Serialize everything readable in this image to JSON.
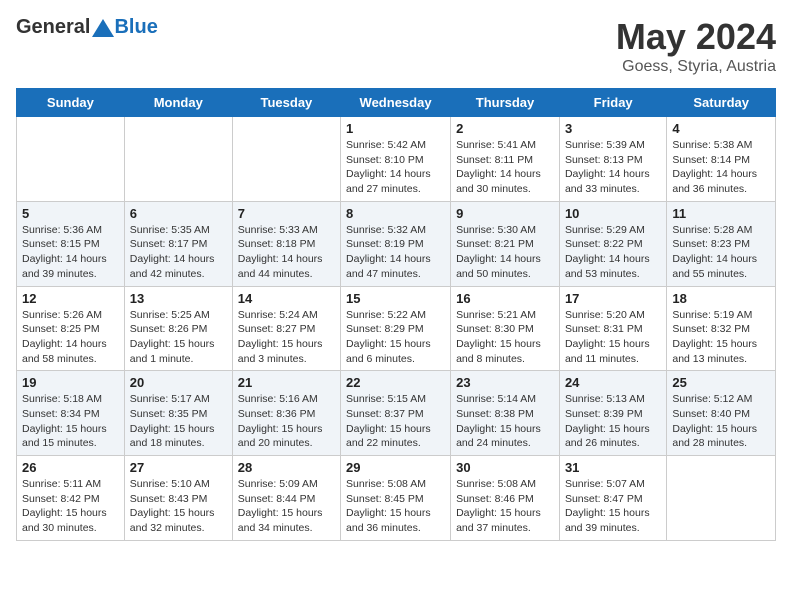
{
  "header": {
    "logo_general": "General",
    "logo_blue": "Blue",
    "title": "May 2024",
    "location": "Goess, Styria, Austria"
  },
  "days_of_week": [
    "Sunday",
    "Monday",
    "Tuesday",
    "Wednesday",
    "Thursday",
    "Friday",
    "Saturday"
  ],
  "weeks": [
    [
      {
        "day": "",
        "info": ""
      },
      {
        "day": "",
        "info": ""
      },
      {
        "day": "",
        "info": ""
      },
      {
        "day": "1",
        "info": "Sunrise: 5:42 AM\nSunset: 8:10 PM\nDaylight: 14 hours and 27 minutes."
      },
      {
        "day": "2",
        "info": "Sunrise: 5:41 AM\nSunset: 8:11 PM\nDaylight: 14 hours and 30 minutes."
      },
      {
        "day": "3",
        "info": "Sunrise: 5:39 AM\nSunset: 8:13 PM\nDaylight: 14 hours and 33 minutes."
      },
      {
        "day": "4",
        "info": "Sunrise: 5:38 AM\nSunset: 8:14 PM\nDaylight: 14 hours and 36 minutes."
      }
    ],
    [
      {
        "day": "5",
        "info": "Sunrise: 5:36 AM\nSunset: 8:15 PM\nDaylight: 14 hours and 39 minutes."
      },
      {
        "day": "6",
        "info": "Sunrise: 5:35 AM\nSunset: 8:17 PM\nDaylight: 14 hours and 42 minutes."
      },
      {
        "day": "7",
        "info": "Sunrise: 5:33 AM\nSunset: 8:18 PM\nDaylight: 14 hours and 44 minutes."
      },
      {
        "day": "8",
        "info": "Sunrise: 5:32 AM\nSunset: 8:19 PM\nDaylight: 14 hours and 47 minutes."
      },
      {
        "day": "9",
        "info": "Sunrise: 5:30 AM\nSunset: 8:21 PM\nDaylight: 14 hours and 50 minutes."
      },
      {
        "day": "10",
        "info": "Sunrise: 5:29 AM\nSunset: 8:22 PM\nDaylight: 14 hours and 53 minutes."
      },
      {
        "day": "11",
        "info": "Sunrise: 5:28 AM\nSunset: 8:23 PM\nDaylight: 14 hours and 55 minutes."
      }
    ],
    [
      {
        "day": "12",
        "info": "Sunrise: 5:26 AM\nSunset: 8:25 PM\nDaylight: 14 hours and 58 minutes."
      },
      {
        "day": "13",
        "info": "Sunrise: 5:25 AM\nSunset: 8:26 PM\nDaylight: 15 hours and 1 minute."
      },
      {
        "day": "14",
        "info": "Sunrise: 5:24 AM\nSunset: 8:27 PM\nDaylight: 15 hours and 3 minutes."
      },
      {
        "day": "15",
        "info": "Sunrise: 5:22 AM\nSunset: 8:29 PM\nDaylight: 15 hours and 6 minutes."
      },
      {
        "day": "16",
        "info": "Sunrise: 5:21 AM\nSunset: 8:30 PM\nDaylight: 15 hours and 8 minutes."
      },
      {
        "day": "17",
        "info": "Sunrise: 5:20 AM\nSunset: 8:31 PM\nDaylight: 15 hours and 11 minutes."
      },
      {
        "day": "18",
        "info": "Sunrise: 5:19 AM\nSunset: 8:32 PM\nDaylight: 15 hours and 13 minutes."
      }
    ],
    [
      {
        "day": "19",
        "info": "Sunrise: 5:18 AM\nSunset: 8:34 PM\nDaylight: 15 hours and 15 minutes."
      },
      {
        "day": "20",
        "info": "Sunrise: 5:17 AM\nSunset: 8:35 PM\nDaylight: 15 hours and 18 minutes."
      },
      {
        "day": "21",
        "info": "Sunrise: 5:16 AM\nSunset: 8:36 PM\nDaylight: 15 hours and 20 minutes."
      },
      {
        "day": "22",
        "info": "Sunrise: 5:15 AM\nSunset: 8:37 PM\nDaylight: 15 hours and 22 minutes."
      },
      {
        "day": "23",
        "info": "Sunrise: 5:14 AM\nSunset: 8:38 PM\nDaylight: 15 hours and 24 minutes."
      },
      {
        "day": "24",
        "info": "Sunrise: 5:13 AM\nSunset: 8:39 PM\nDaylight: 15 hours and 26 minutes."
      },
      {
        "day": "25",
        "info": "Sunrise: 5:12 AM\nSunset: 8:40 PM\nDaylight: 15 hours and 28 minutes."
      }
    ],
    [
      {
        "day": "26",
        "info": "Sunrise: 5:11 AM\nSunset: 8:42 PM\nDaylight: 15 hours and 30 minutes."
      },
      {
        "day": "27",
        "info": "Sunrise: 5:10 AM\nSunset: 8:43 PM\nDaylight: 15 hours and 32 minutes."
      },
      {
        "day": "28",
        "info": "Sunrise: 5:09 AM\nSunset: 8:44 PM\nDaylight: 15 hours and 34 minutes."
      },
      {
        "day": "29",
        "info": "Sunrise: 5:08 AM\nSunset: 8:45 PM\nDaylight: 15 hours and 36 minutes."
      },
      {
        "day": "30",
        "info": "Sunrise: 5:08 AM\nSunset: 8:46 PM\nDaylight: 15 hours and 37 minutes."
      },
      {
        "day": "31",
        "info": "Sunrise: 5:07 AM\nSunset: 8:47 PM\nDaylight: 15 hours and 39 minutes."
      },
      {
        "day": "",
        "info": ""
      }
    ]
  ]
}
